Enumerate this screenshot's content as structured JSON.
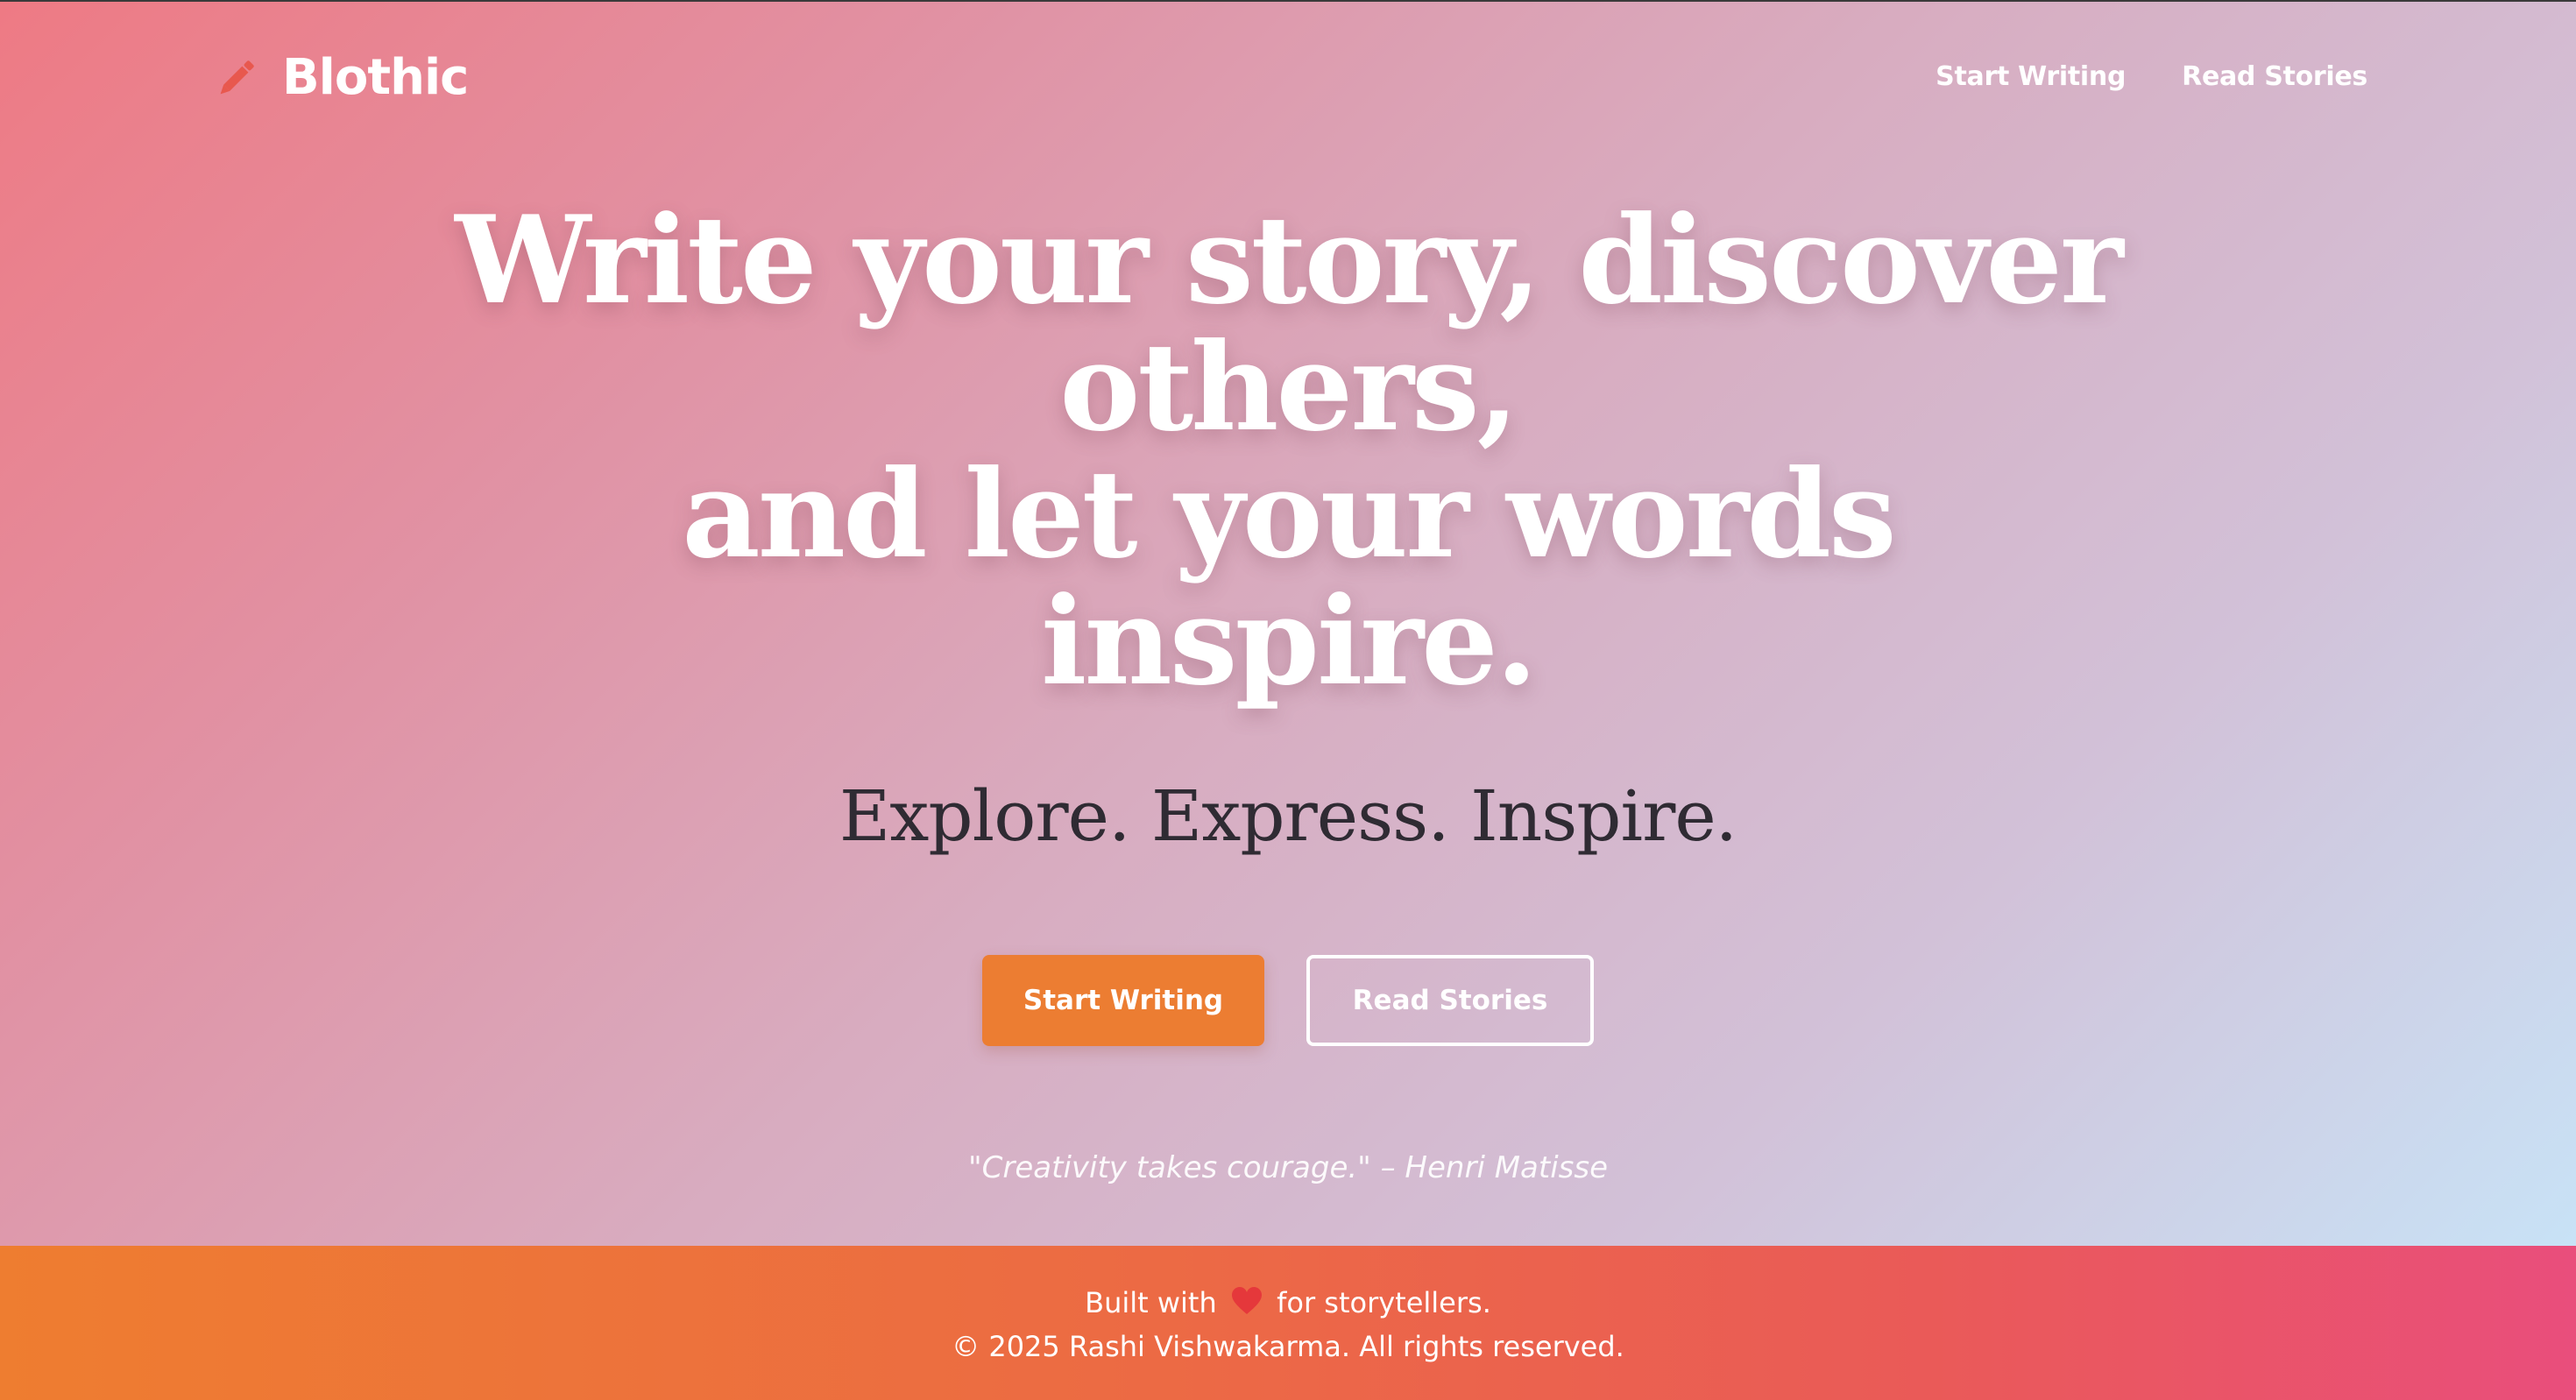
{
  "header": {
    "brand_name": "Blothic",
    "brand_icon": "pencil-icon",
    "brand_icon_color": "#e8584e",
    "nav": [
      {
        "label": "Start Writing"
      },
      {
        "label": "Read Stories"
      }
    ]
  },
  "hero": {
    "headline_lines": [
      "Write your story, discover",
      "others,",
      "and let your words",
      "inspire."
    ],
    "tagline": "Explore. Express. Inspire.",
    "primary_button": "Start Writing",
    "secondary_button": "Read Stories",
    "quote": "\"Creativity takes courage.\" – Henri Matisse"
  },
  "footer": {
    "line1_prefix": "Built with",
    "heart_icon": "heart-icon",
    "line1_suffix": "for storytellers.",
    "line2": "© 2025 Rashi Vishwakarma. All rights reserved."
  },
  "colors": {
    "accent": "#ec7d32",
    "hero_gradient_start": "#ee7a84",
    "hero_gradient_end": "#c8e2f6",
    "footer_gradient_start": "#ee7d30",
    "footer_gradient_end": "#e94e7c",
    "heart": "#e5383b"
  }
}
